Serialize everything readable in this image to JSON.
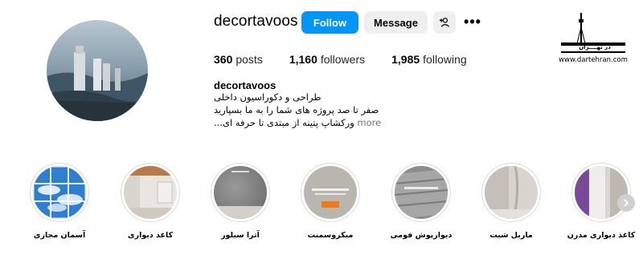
{
  "profile": {
    "username": "decortavoos",
    "display_name": "decortavoos",
    "follow_label": "Follow",
    "message_label": "Message",
    "more_label": "•••",
    "stats": {
      "posts_count": "360",
      "posts_label": "posts",
      "followers_count": "1,160",
      "followers_label": "followers",
      "following_count": "1,985",
      "following_label": "following"
    },
    "bio": {
      "line1": "طراحی و دکوراسیون داخلی",
      "line2": "صفر تا صد پروژه های شما را به ما بسپارید",
      "line3": "...ورکشاپ پتینه از مبتدی تا حرفه ای",
      "more_label": "more"
    }
  },
  "watermark": {
    "title": "در تهــــران",
    "url": "www.dartehran.com"
  },
  "highlights": [
    {
      "label": "آسمان مجازی"
    },
    {
      "label": "کاغذ دیواری"
    },
    {
      "label": "آترا سیلور"
    },
    {
      "label": "میکروسمنت"
    },
    {
      "label": "دیوارپوش فومی"
    },
    {
      "label": "ماربل شیت"
    },
    {
      "label": "کاغذ دیواری مدرن"
    }
  ],
  "icons": {
    "add_user": "add-user-icon",
    "more": "more-dots-icon",
    "next": "chevron-right-icon"
  }
}
